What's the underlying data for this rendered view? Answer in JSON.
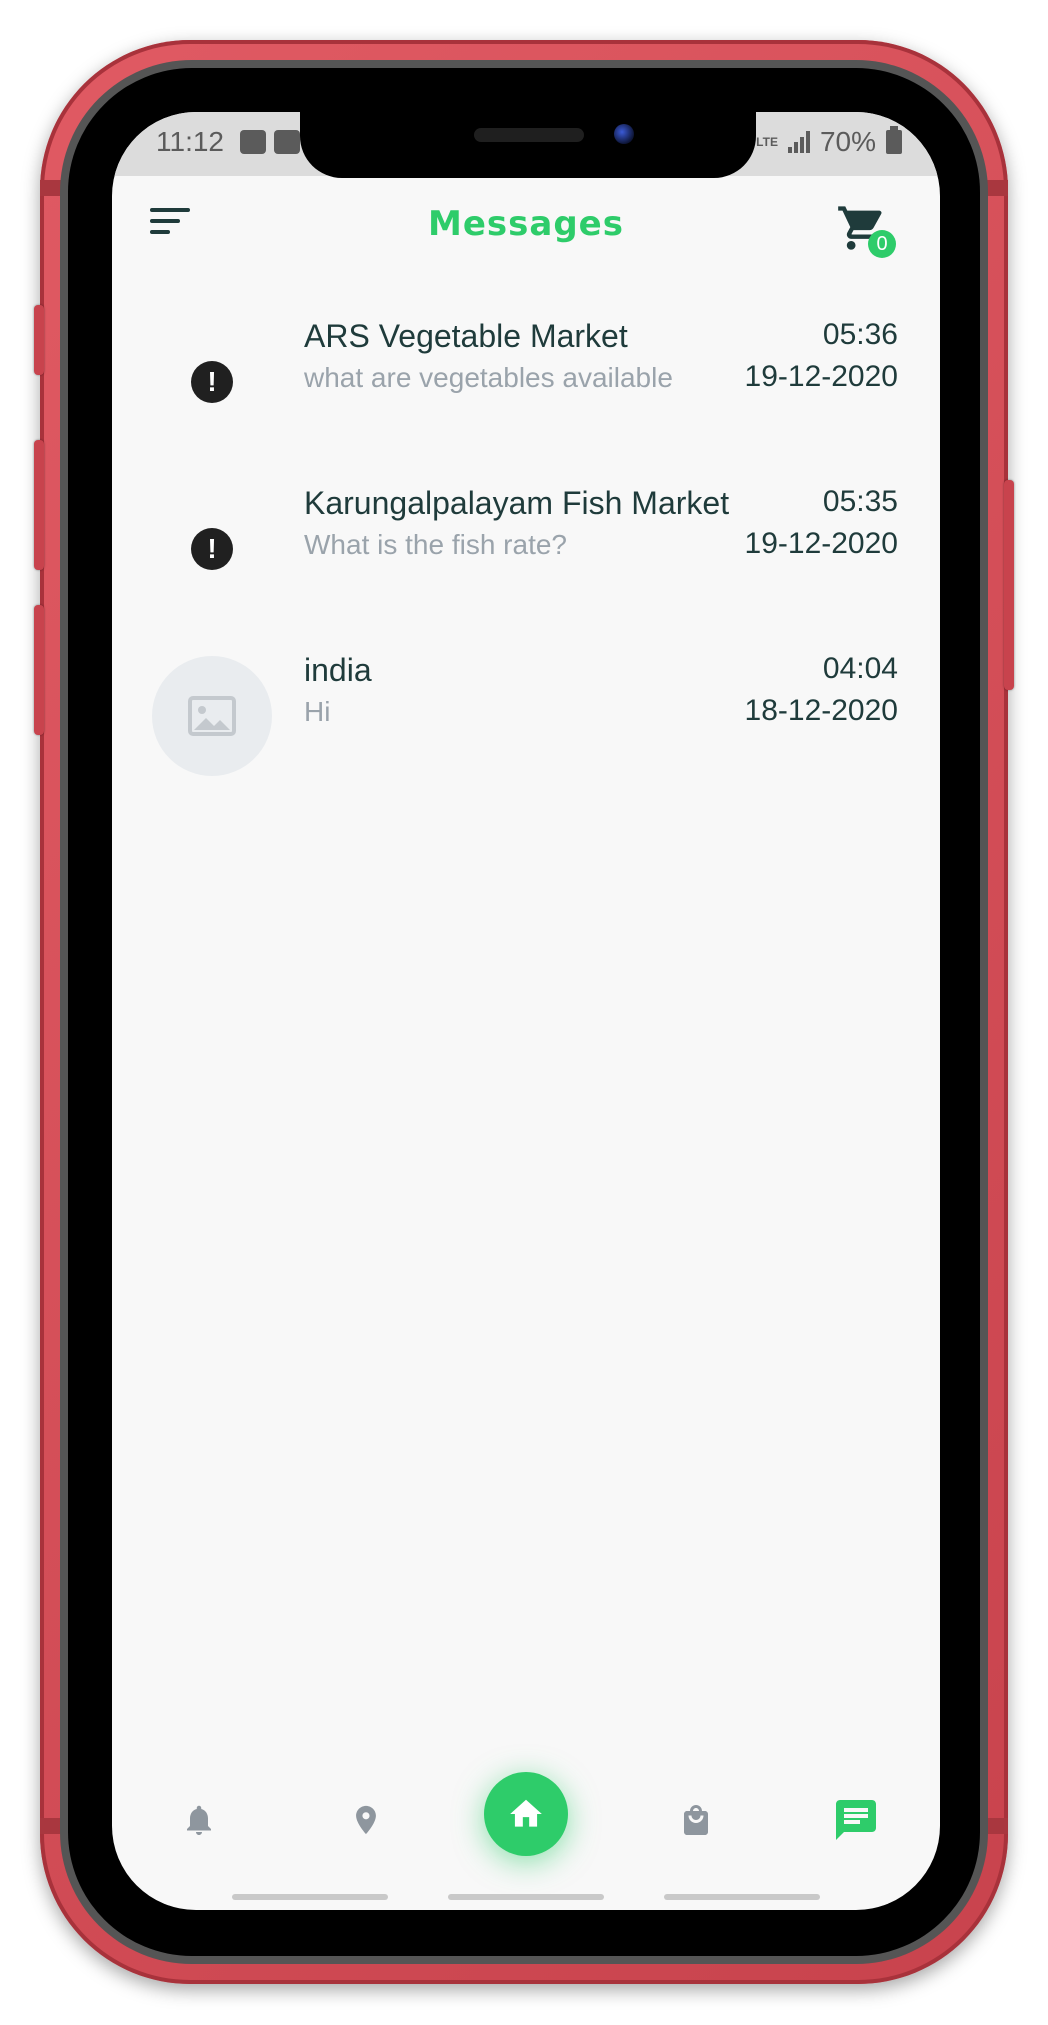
{
  "status_bar": {
    "time": "11:12",
    "battery": "70%"
  },
  "header": {
    "title": "Messages",
    "cart_count": "0"
  },
  "messages": [
    {
      "name": "ARS Vegetable Market",
      "preview": "what are vegetables available",
      "time": "05:36",
      "date": "19-12-2020",
      "avatar": "alert-icon"
    },
    {
      "name": "Karungalpalayam Fish Market",
      "preview": "What is the fish rate?",
      "time": "05:35",
      "date": "19-12-2020",
      "avatar": "alert-icon"
    },
    {
      "name": "india",
      "preview": "Hi",
      "time": "04:04",
      "date": "18-12-2020",
      "avatar": "image-placeholder-icon"
    }
  ],
  "bottom_nav": {
    "items": [
      "bell-icon",
      "location-pin-icon",
      "home-icon",
      "shopping-bag-icon",
      "chat-icon"
    ],
    "active": "chat-icon"
  },
  "colors": {
    "accent": "#2ecc6a",
    "text_dark": "#1f3b3b",
    "text_muted": "#9aa3ab",
    "frame": "#c8434d"
  }
}
